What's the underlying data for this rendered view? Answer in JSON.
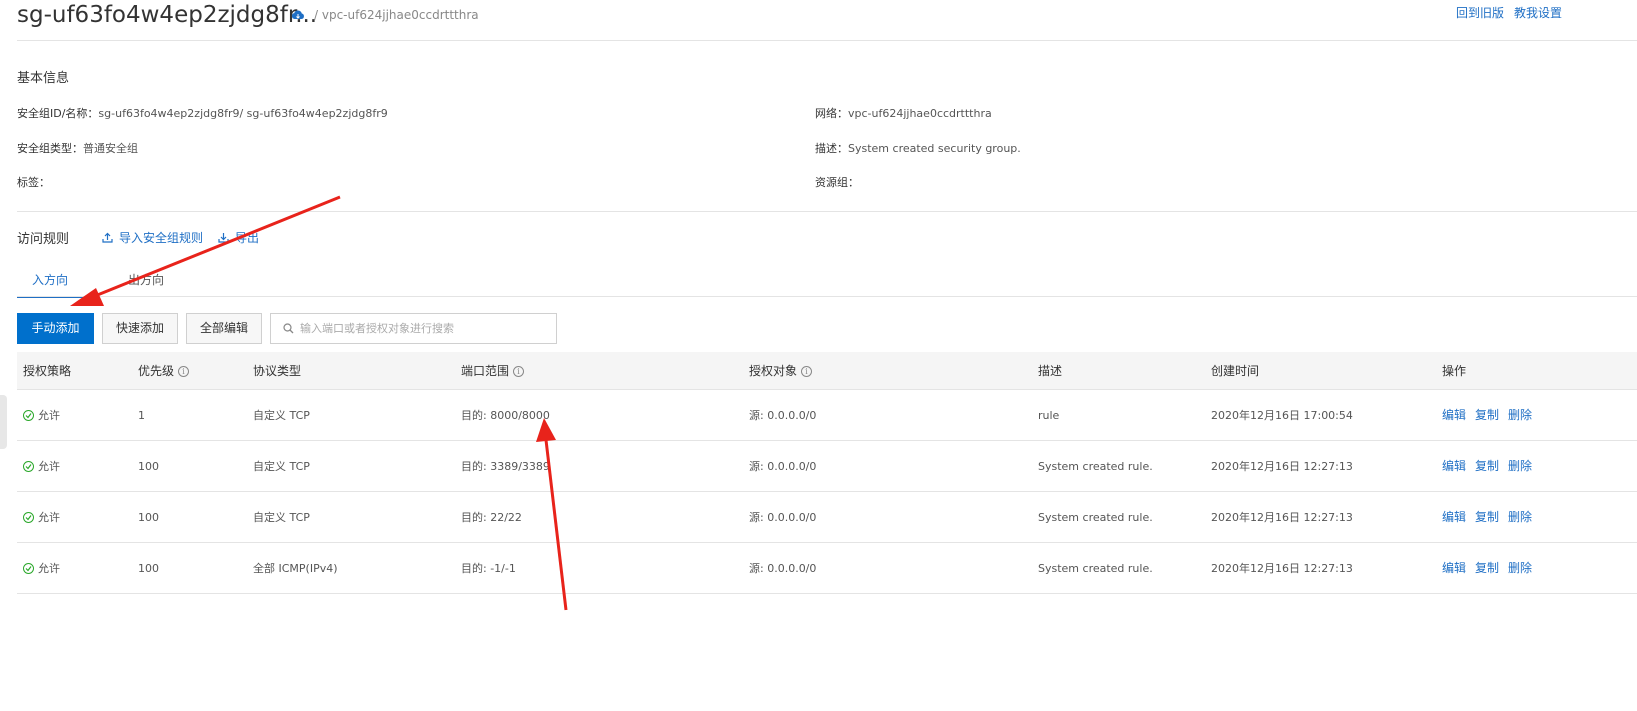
{
  "header": {
    "title": "sg-uf63fo4w4ep2zjdg8fr...",
    "vpc": "/ vpc-uf624jjhae0ccdrttthra",
    "links": [
      "回到旧版",
      "教我设置"
    ]
  },
  "basic_info": {
    "title": "基本信息",
    "sg_id_label": "安全组ID/名称：",
    "sg_id_value": "sg-uf63fo4w4ep2zjdg8fr9/ sg-uf63fo4w4ep2zjdg8fr9",
    "network_label": "网络：",
    "network_value": "vpc-uf624jjhae0ccdrttthra",
    "type_label": "安全组类型：",
    "type_value": "普通安全组",
    "desc_label": "描述：",
    "desc_value": "System created security group.",
    "tag_label": "标签：",
    "resource_group_label": "资源组："
  },
  "rules": {
    "title": "访问规则",
    "import_label": "导入安全组规则",
    "export_label": "导出",
    "tabs": [
      "入方向",
      "出方向"
    ],
    "active_tab": 0
  },
  "toolbar": {
    "manual_add": "手动添加",
    "quick_add": "快速添加",
    "edit_all": "全部编辑",
    "search_placeholder": "输入端口或者授权对象进行搜索"
  },
  "table": {
    "columns": [
      "授权策略",
      "优先级",
      "协议类型",
      "端口范围",
      "授权对象",
      "描述",
      "创建时间",
      "操作"
    ],
    "rows": [
      {
        "policy": "允许",
        "priority": "1",
        "protocol": "自定义 TCP",
        "port": "目的: 8000/8000",
        "source": "源: 0.0.0.0/0",
        "desc": "rule",
        "created": "2020年12月16日 17:00:54"
      },
      {
        "policy": "允许",
        "priority": "100",
        "protocol": "自定义 TCP",
        "port": "目的: 3389/3389",
        "source": "源: 0.0.0.0/0",
        "desc": "System created rule.",
        "created": "2020年12月16日 12:27:13"
      },
      {
        "policy": "允许",
        "priority": "100",
        "protocol": "自定义 TCP",
        "port": "目的: 22/22",
        "source": "源: 0.0.0.0/0",
        "desc": "System created rule.",
        "created": "2020年12月16日 12:27:13"
      },
      {
        "policy": "允许",
        "priority": "100",
        "protocol": "全部 ICMP(IPv4)",
        "port": "目的: -1/-1",
        "source": "源: 0.0.0.0/0",
        "desc": "System created rule.",
        "created": "2020年12月16日 12:27:13"
      }
    ],
    "actions": [
      "编辑",
      "复制",
      "删除"
    ]
  },
  "colors": {
    "accent": "#1f6fc5",
    "primary_button": "#0070cc",
    "allow_green": "#2ba82b",
    "annotation_red": "#e8231b"
  },
  "icons": [
    "cloud-icon",
    "upload-icon",
    "download-icon",
    "search-icon",
    "info-icon",
    "check-circle-icon",
    "annotation-arrow"
  ]
}
